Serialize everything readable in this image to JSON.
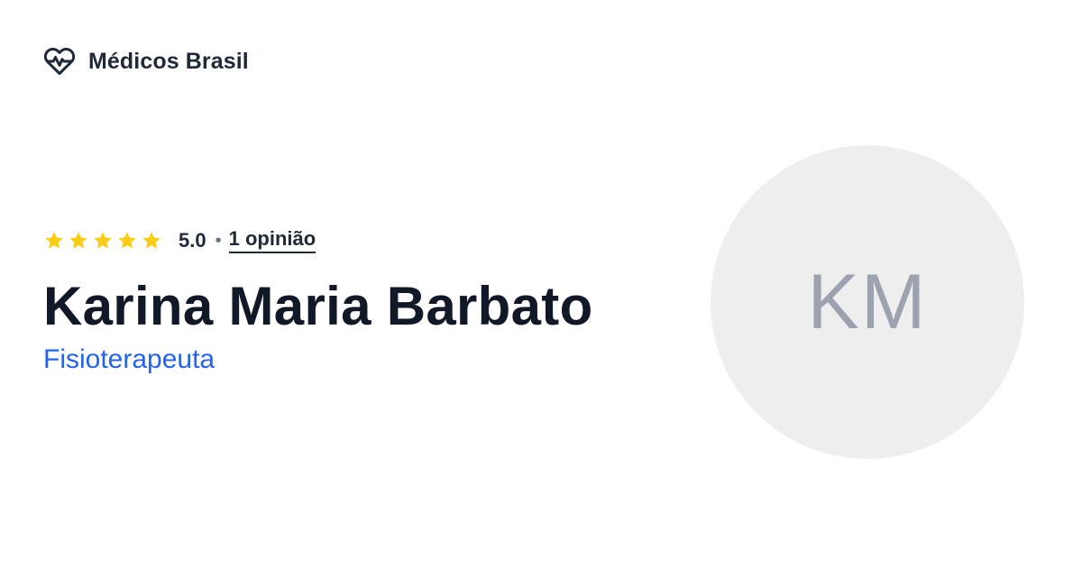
{
  "brand": {
    "name": "Médicos Brasil",
    "logo_icon": "heart-pulse-icon"
  },
  "rating": {
    "stars": 5,
    "star_color": "#facc15",
    "score": "5.0",
    "separator": "•",
    "reviews_label": "1 opinião"
  },
  "doctor": {
    "name": "Karina Maria Barbato",
    "specialty": "Fisioterapeuta",
    "initials": "KM"
  },
  "colors": {
    "specialty": "#2563eb",
    "text": "#111827",
    "avatar_bg": "#eeeeee",
    "avatar_text": "#9ca3af"
  }
}
